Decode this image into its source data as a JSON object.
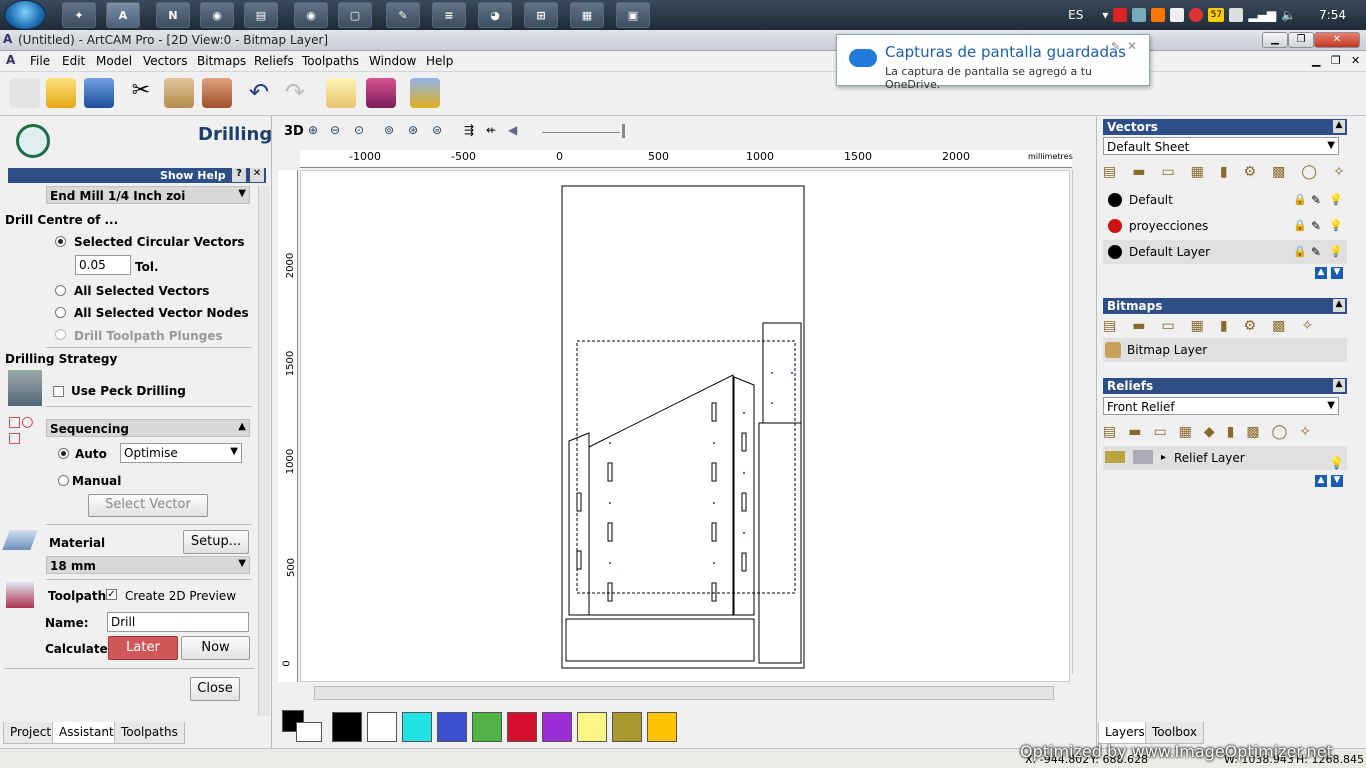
{
  "taskbar": {
    "lang": "ES",
    "clock": "7:54",
    "badge": "57"
  },
  "window": {
    "title": "(Untitled) - ArtCAM Pro - [2D View:0 - Bitmap Layer]"
  },
  "menu": [
    "File",
    "Edit",
    "Model",
    "Vectors",
    "Bitmaps",
    "Reliefs",
    "Toolpaths",
    "Window",
    "Help"
  ],
  "toast": {
    "title": "Capturas de pantalla guardadas",
    "message": "La captura de pantalla se agregó a tu OneDrive."
  },
  "left": {
    "heading": "Drilling",
    "show_help": "Show Help",
    "tool": "End Mill 1/4 Inch zoi",
    "drill_centre": "Drill Centre of ...",
    "opt_selected_circular": "Selected Circular Vectors",
    "tol_value": "0.05",
    "tol_label": "Tol.",
    "opt_all_selected": "All Selected Vectors",
    "opt_all_nodes": "All Selected Vector Nodes",
    "opt_plunges": "Drill Toolpath Plunges",
    "strategy": "Drilling Strategy",
    "peck": "Use Peck Drilling",
    "sequencing": "Sequencing",
    "auto": "Auto",
    "auto_select": "Optimise",
    "manual": "Manual",
    "select_vector": "Select Vector",
    "material": "Material",
    "setup": "Setup...",
    "thickness": "18 mm",
    "toolpath": "Toolpath",
    "preview": "Create 2D Preview",
    "name_label": "Name:",
    "name_value": "Drill",
    "calculate": "Calculate",
    "later": "Later",
    "now": "Now",
    "close": "Close",
    "tabs": [
      "Project",
      "Assistant",
      "Toolpaths"
    ]
  },
  "view": {
    "mode3d": "3D",
    "ruler_x": [
      "-1000",
      "-500",
      "0",
      "500",
      "1000",
      "1500",
      "2000"
    ],
    "units": "millimetres",
    "ruler_y": [
      "2000",
      "1500",
      "1000",
      "500",
      "0"
    ]
  },
  "palette": [
    "#000000",
    "#ffffff",
    "#22e3e3",
    "#3b50d0",
    "#52b447",
    "#d4102c",
    "#9b2ed6",
    "#fbf683",
    "#a8982e",
    "#fec300"
  ],
  "right": {
    "vectors_title": "Vectors",
    "vectors_sheet": "Default Sheet",
    "vector_layers": [
      {
        "name": "Default",
        "color": "#000000"
      },
      {
        "name": "proyecciones",
        "color": "#cc1111"
      },
      {
        "name": "Default Layer",
        "color": "#000000"
      }
    ],
    "bitmaps_title": "Bitmaps",
    "bitmap_layer": "Bitmap Layer",
    "reliefs_title": "Reliefs",
    "relief_select": "Front Relief",
    "relief_layer": "Relief Layer",
    "tabs": [
      "Layers",
      "Toolbox"
    ]
  },
  "status": {
    "x": "X: -944.802",
    "y": "Y: 688.628",
    "w": "W: 1038.943",
    "h": "H: 1268.845"
  },
  "watermark": "Optimized by www.ImageOptimizer.net"
}
